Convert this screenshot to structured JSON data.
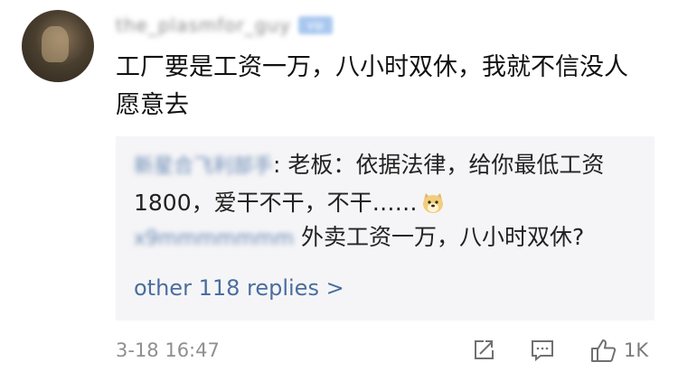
{
  "comment": {
    "username": "the_plasmfor_guy",
    "badge": "vip",
    "text": "工厂要是工资一万，八小时双休，我就不信没人愿意去",
    "timestamp": "3-18 16:47",
    "like_count": "1K"
  },
  "replies": [
    {
      "author": "新星合飞利部手",
      "text": "老板：依据法律，给你最低工资1800，爱干不干，不干……",
      "emoji": "doge-icon"
    },
    {
      "author": "x9mmmmmmm",
      "text": "外卖工资一万，八小时双休?"
    }
  ],
  "more_replies": "other 118 replies >",
  "colors": {
    "link": "#4a6e9e",
    "reply_bg": "#f5f5f7",
    "meta_text": "#8f8f8f"
  }
}
